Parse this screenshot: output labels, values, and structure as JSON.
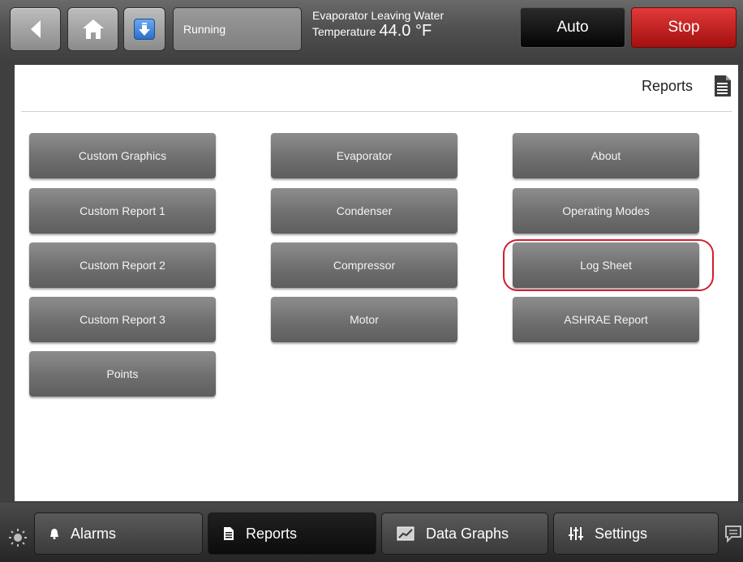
{
  "header": {
    "back_icon": "chevron-left-icon",
    "home_icon": "home-icon",
    "download_icon": "download-arrow-icon",
    "status": "Running",
    "readout_label_line1": "Evaporator Leaving Water",
    "readout_label_line2": "Temperature",
    "readout_value": "44.0 °F",
    "auto_label": "Auto",
    "stop_label": "Stop"
  },
  "panel": {
    "title": "Reports",
    "title_icon": "document-icon",
    "columns": [
      [
        "Custom Graphics",
        "Custom Report 1",
        "Custom Report 2",
        "Custom Report 3",
        "Points"
      ],
      [
        "Evaporator",
        "Condenser",
        "Compressor",
        "Motor"
      ],
      [
        "About",
        "Operating Modes",
        "Log Sheet",
        "ASHRAE Report"
      ]
    ],
    "highlighted": "Log Sheet"
  },
  "footer": {
    "brightness_icon": "sun-icon",
    "tabs": [
      {
        "label": "Alarms",
        "icon": "bell-icon"
      },
      {
        "label": "Reports",
        "icon": "document-icon",
        "active": true
      },
      {
        "label": "Data Graphs",
        "icon": "chart-icon"
      },
      {
        "label": "Settings",
        "icon": "sliders-icon"
      }
    ],
    "chat_icon": "chat-icon"
  },
  "colors": {
    "stop": "#c01818",
    "auto": "#111111",
    "highlight": "#d21f2c",
    "accent_blue": "#2c6fc6"
  }
}
